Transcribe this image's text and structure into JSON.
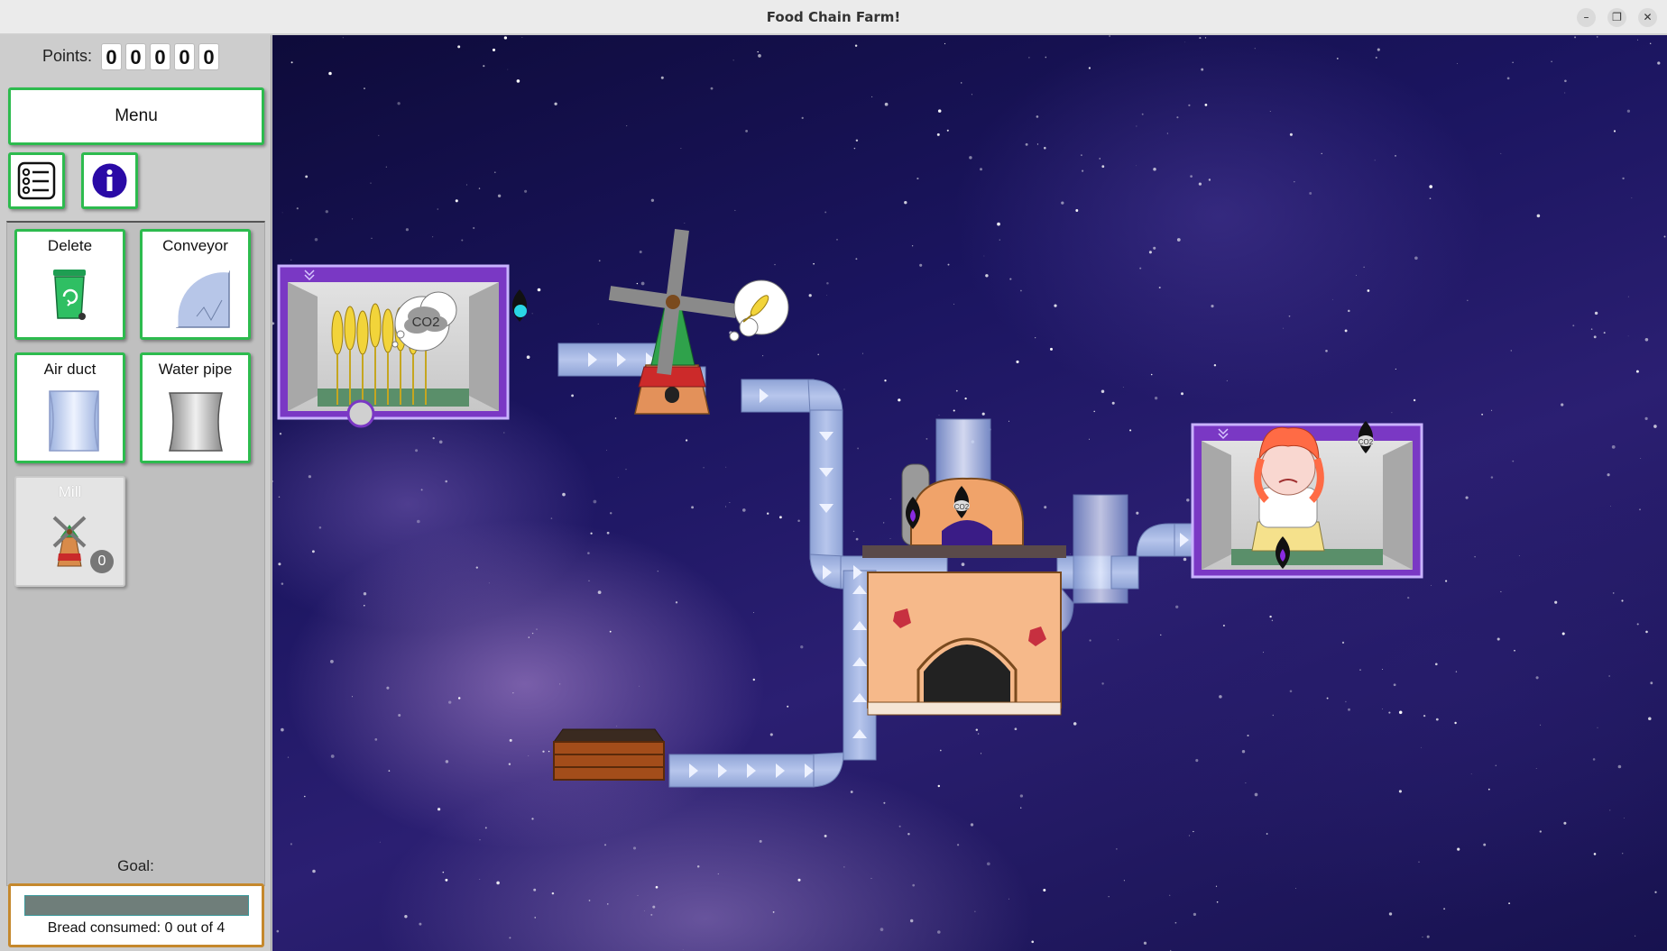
{
  "window": {
    "title": "Food Chain Farm!"
  },
  "sidebar": {
    "points_label": "Points:",
    "points_digits": [
      "0",
      "0",
      "0",
      "0",
      "0"
    ],
    "menu_label": "Menu",
    "tools": [
      {
        "label": "Delete",
        "icon": "recycle-bin-icon"
      },
      {
        "label": "Conveyor",
        "icon": "conveyor-icon"
      },
      {
        "label": "Air duct",
        "icon": "air-duct-icon"
      },
      {
        "label": "Water pipe",
        "icon": "water-pipe-icon"
      },
      {
        "label": "Mill",
        "icon": "mill-icon",
        "count": "0"
      }
    ],
    "goal_label": "Goal:",
    "goal_text": "Bread consumed: 0 out of 4",
    "goal_progress": 0.0
  },
  "board": {
    "greenhouse_bubble": "CO2",
    "oven_bubble": "CO2",
    "person_bubble": "CO2"
  }
}
